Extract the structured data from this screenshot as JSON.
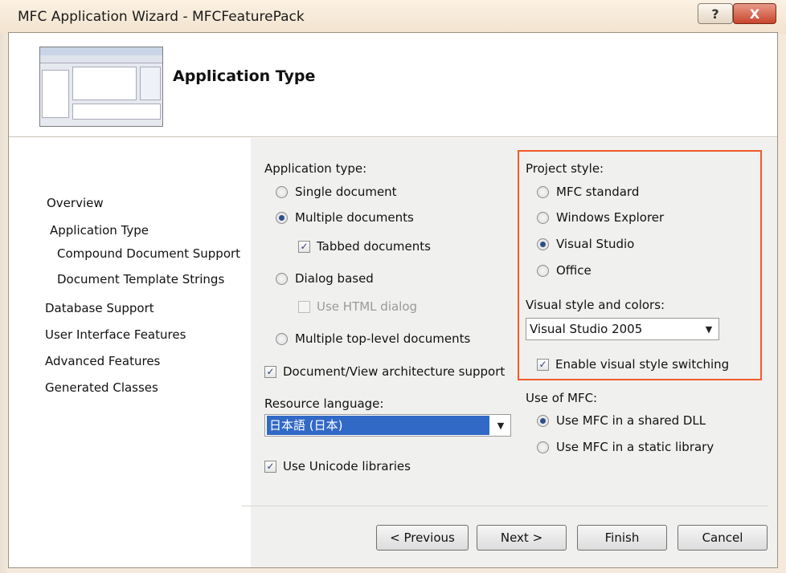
{
  "window": {
    "title": "MFC Application Wizard - MFCFeaturePack",
    "help_glyph": "?",
    "close_glyph": "X"
  },
  "header": {
    "page_title": "Application Type"
  },
  "nav": {
    "items": [
      "Overview",
      "Application Type",
      "Compound Document Support",
      "Document Template Strings",
      "Database Support",
      "User Interface Features",
      "Advanced Features",
      "Generated Classes"
    ]
  },
  "app_type": {
    "label": "Application type:",
    "single": "Single document",
    "multiple": "Multiple documents",
    "tabbed": "Tabbed documents",
    "dialog": "Dialog based",
    "html_dialog": "Use HTML dialog",
    "multi_top": "Multiple top-level documents",
    "selected": "multiple",
    "tabbed_checked": true,
    "html_dialog_checked": false
  },
  "doc_view": {
    "label": "Document/View architecture support",
    "checked": true
  },
  "resource_language": {
    "label": "Resource language:",
    "value": "日本語 (日本)"
  },
  "unicode": {
    "label": "Use Unicode libraries",
    "checked": true
  },
  "project_style": {
    "label": "Project style:",
    "mfc_standard": "MFC standard",
    "windows_explorer": "Windows Explorer",
    "visual_studio": "Visual Studio",
    "office": "Office",
    "selected": "visual_studio"
  },
  "visual_style": {
    "label": "Visual style and colors:",
    "value": "Visual Studio 2005",
    "switching_label": "Enable visual style switching",
    "switching_checked": true
  },
  "mfc_use": {
    "label": "Use of MFC:",
    "shared": "Use MFC in a shared DLL",
    "static": "Use MFC in a static library",
    "selected": "shared"
  },
  "buttons": {
    "previous": "< Previous",
    "next": "Next >",
    "finish": "Finish",
    "cancel": "Cancel"
  },
  "colors": {
    "highlight_border": "#f25a2a",
    "selection": "#3169c6"
  }
}
